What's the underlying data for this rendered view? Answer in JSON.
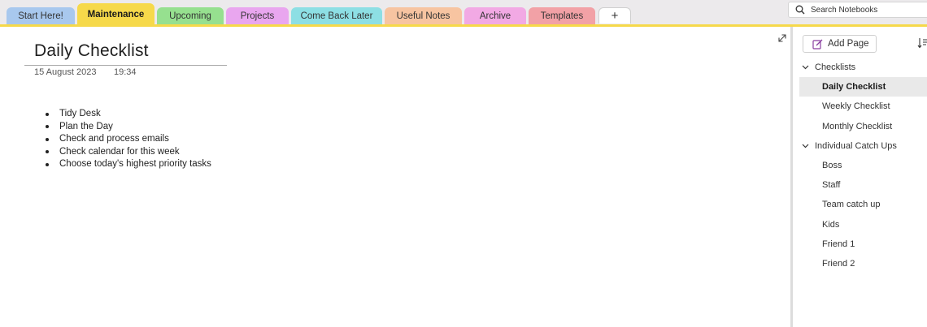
{
  "tabs": [
    {
      "label": "Start Here!",
      "color": "#a8c8ee",
      "active": false
    },
    {
      "label": "Maintenance",
      "color": "#f6d94a",
      "active": true
    },
    {
      "label": "Upcoming",
      "color": "#96e08f",
      "active": false
    },
    {
      "label": "Projects",
      "color": "#e9a6ef",
      "active": false
    },
    {
      "label": "Come Back Later",
      "color": "#8ddfe4",
      "active": false
    },
    {
      "label": "Useful Notes",
      "color": "#f7c4a1",
      "active": false
    },
    {
      "label": "Archive",
      "color": "#f2a9e4",
      "active": false
    },
    {
      "label": "Templates",
      "color": "#f2a1a6",
      "active": false
    }
  ],
  "add_tab_label": "+",
  "search": {
    "placeholder": "Search Notebooks"
  },
  "page": {
    "title": "Daily Checklist",
    "date": "15 August 2023",
    "time": "19:34",
    "bullets": [
      "Tidy Desk",
      "Plan the Day",
      "Check and process emails",
      "Check calendar for this week",
      "Choose today's highest priority tasks"
    ]
  },
  "pane": {
    "add_page_label": "Add Page",
    "sections": [
      {
        "label": "Checklists",
        "pages": [
          {
            "label": "Daily Checklist",
            "selected": true
          },
          {
            "label": "Weekly Checklist",
            "selected": false
          },
          {
            "label": "Monthly Checklist",
            "selected": false
          }
        ]
      },
      {
        "label": "Individual Catch Ups",
        "pages": [
          {
            "label": "Boss",
            "selected": false
          },
          {
            "label": "Staff",
            "selected": false
          },
          {
            "label": "Team catch up",
            "selected": false
          },
          {
            "label": "Kids",
            "selected": false
          },
          {
            "label": "Friend 1",
            "selected": false
          },
          {
            "label": "Friend 2",
            "selected": false
          }
        ]
      }
    ]
  },
  "colors": {
    "accent": "#f6d94a",
    "add_page_icon": "#8a3fa0",
    "selected_row": "#e9e9e9"
  }
}
